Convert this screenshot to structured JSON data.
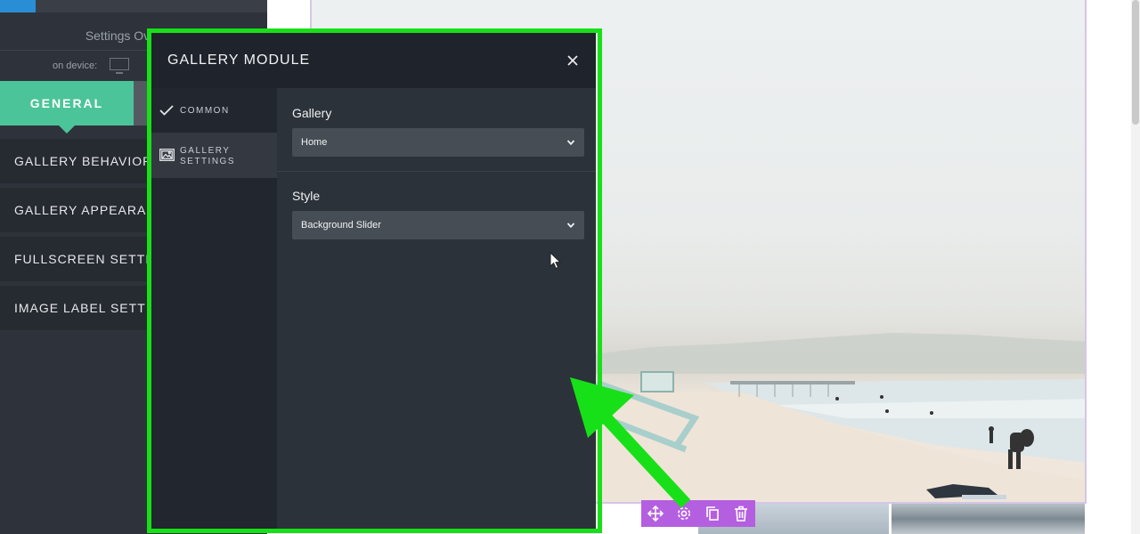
{
  "left_panel": {
    "settings_overview": "Settings Ov",
    "on_device_label": "on device:",
    "tab_general": "GENERAL",
    "sections": [
      "GALLERY BEHAVIOR",
      "GALLERY APPEARANCE",
      "FULLSCREEN SETTINGS",
      "IMAGE LABEL SETTINGS"
    ]
  },
  "modal": {
    "title": "GALLERY MODULE",
    "nav": {
      "common": "COMMON",
      "gallery_settings_line1": "GALLERY",
      "gallery_settings_line2": "SETTINGS"
    },
    "fields": {
      "gallery_label": "Gallery",
      "gallery_value": "Home",
      "style_label": "Style",
      "style_value": "Background Slider"
    }
  },
  "colors": {
    "accent_green_tab": "#4bc49a",
    "highlight_green": "#18e018",
    "toolbar_purple": "#b45fe0",
    "modal_bg": "#2c323a"
  },
  "icons": {
    "close": "close-icon",
    "check": "check-icon",
    "image": "image-icon",
    "toolbar": [
      "move-icon",
      "gear-icon",
      "copy-icon",
      "trash-icon"
    ]
  }
}
